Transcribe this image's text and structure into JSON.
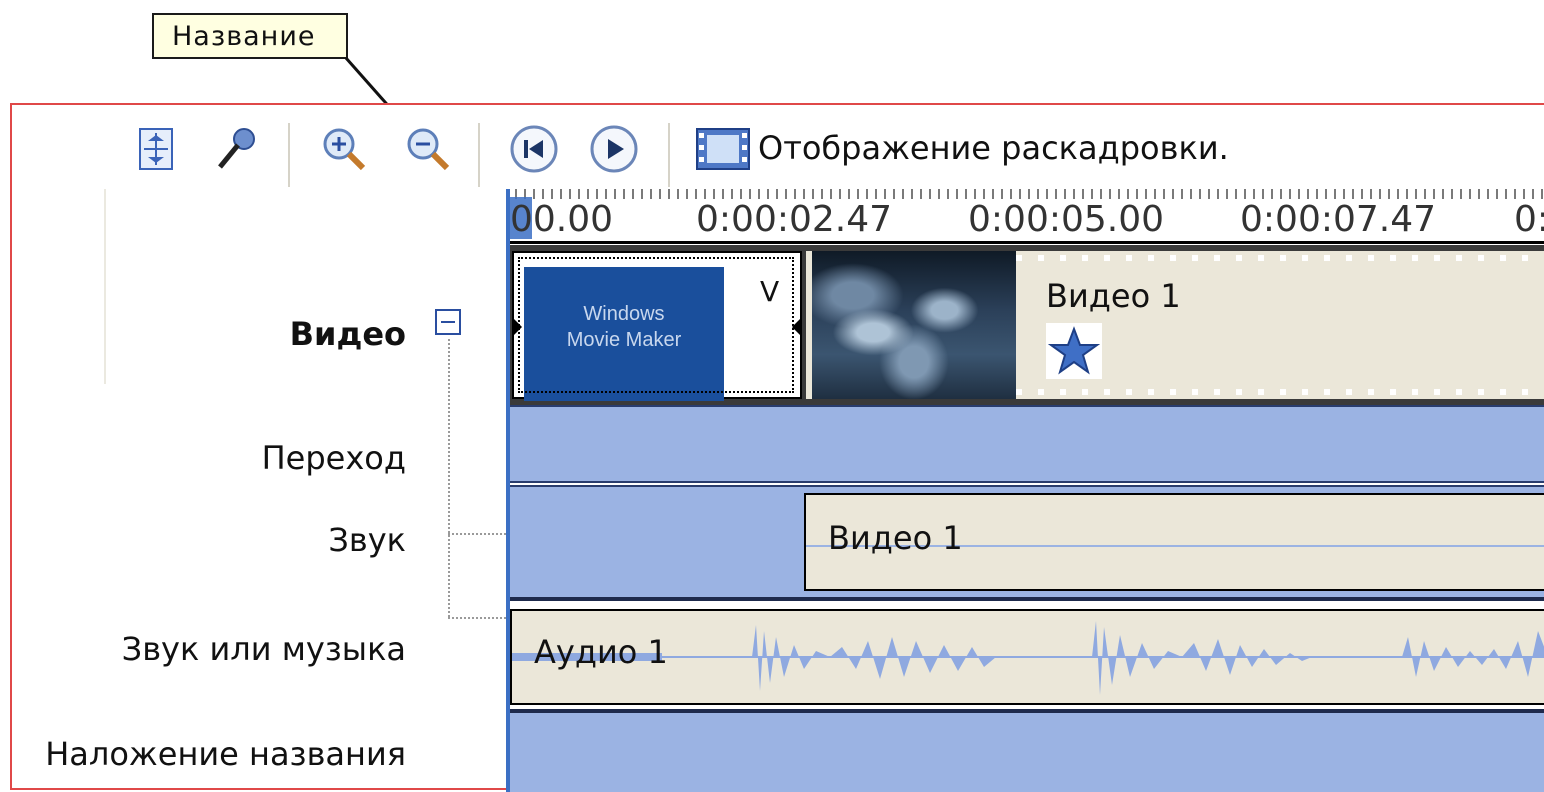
{
  "callout": {
    "label": "Название"
  },
  "toolbar": {
    "storyboard_label": "Отображение раскадровки."
  },
  "ruler": {
    "ticks": [
      "00.00",
      "0:00:02.47",
      "0:00:05.00",
      "0:00:07.47",
      "0:"
    ]
  },
  "tracks": {
    "video": "Видео",
    "transition": "Переход",
    "audio": "Звук",
    "music": "Звук или музыка",
    "title_overlay": "Наложение названия"
  },
  "clips": {
    "title_thumb_line1": "Windows",
    "title_thumb_line2": "Movie Maker",
    "title_clip_letter": "V",
    "video_clip_name": "Видео 1",
    "audio_clip_name": "Видео 1",
    "music_clip_name": "Аудио 1"
  },
  "icons": {
    "set_audio_levels": "audio-levels-icon",
    "narrate": "microphone-icon",
    "zoom_in": "zoom-in-icon",
    "zoom_out": "zoom-out-icon",
    "rewind": "rewind-icon",
    "play": "play-icon",
    "storyboard": "filmstrip-icon",
    "effect": "star-effect-icon"
  },
  "colors": {
    "track_blue": "#9bb3e3",
    "clip_bg": "#ebe7d9",
    "playhead": "#3b6fc4",
    "frame_border": "#e04848"
  }
}
